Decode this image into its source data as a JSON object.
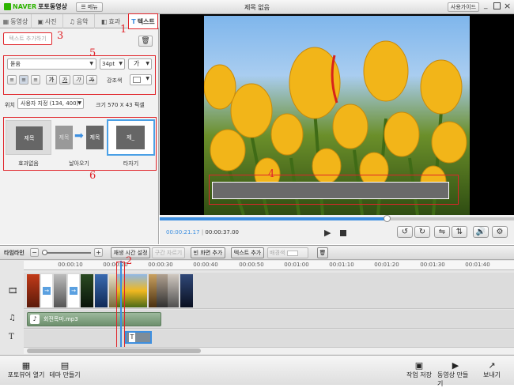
{
  "app": {
    "brand": "NAVER",
    "product": "포토동영상",
    "menu_label": "메뉴",
    "window_title": "제목 없음",
    "guide_label": "사용가이드"
  },
  "tabs": [
    {
      "label": "동영상",
      "icon": "film-icon"
    },
    {
      "label": "사진",
      "icon": "photo-icon"
    },
    {
      "label": "음악",
      "icon": "music-icon"
    },
    {
      "label": "효과",
      "icon": "effect-icon"
    },
    {
      "label": "텍스트",
      "icon": "text-icon",
      "active": true
    }
  ],
  "text_panel": {
    "add_text_label": "텍스트 추가하기",
    "font_value": "돋움",
    "size_value": "34pt",
    "color_glyph": "가",
    "style_glyphs": [
      "가",
      "가",
      "가",
      "가"
    ],
    "outline_label": "강조색",
    "position_label": "위치",
    "position_value": "사용자 지정 (134, 400)",
    "size_info": "크기  570 X 43 픽셀",
    "effects": [
      {
        "preview": "제목",
        "label": "효과없음"
      },
      {
        "preview": "제목",
        "label": "날아오기"
      },
      {
        "preview": "제_",
        "label": "타자기"
      }
    ]
  },
  "annotations": [
    "1",
    "2",
    "3",
    "4",
    "5",
    "6"
  ],
  "player": {
    "time_current": "00:00:21.17",
    "time_total": "00:00:37.00",
    "progress": 0.64
  },
  "timeline": {
    "label": "타임라인",
    "buttons": [
      "재생 시간 설정",
      "구간 자르기",
      "빈 화면 추가",
      "텍스트 추가",
      "배경색"
    ],
    "ruler": [
      "00:00:10",
      "00:00:20",
      "00:00:30",
      "00:00:40",
      "00:00:50",
      "00:01:00",
      "00:01:10",
      "00:01:20",
      "00:01:30",
      "00:01:40"
    ],
    "music_clip": "회전목마.mp3",
    "text_clip_glyph": "T"
  },
  "bottom": {
    "left": [
      "포토뷰어 열기",
      "테마 만들기"
    ],
    "right": [
      "작업 저장",
      "동영상 만들기",
      "보내기"
    ]
  },
  "colors": {
    "accent_blue": "#3d8fe0",
    "annotation_red": "#e0242a"
  }
}
